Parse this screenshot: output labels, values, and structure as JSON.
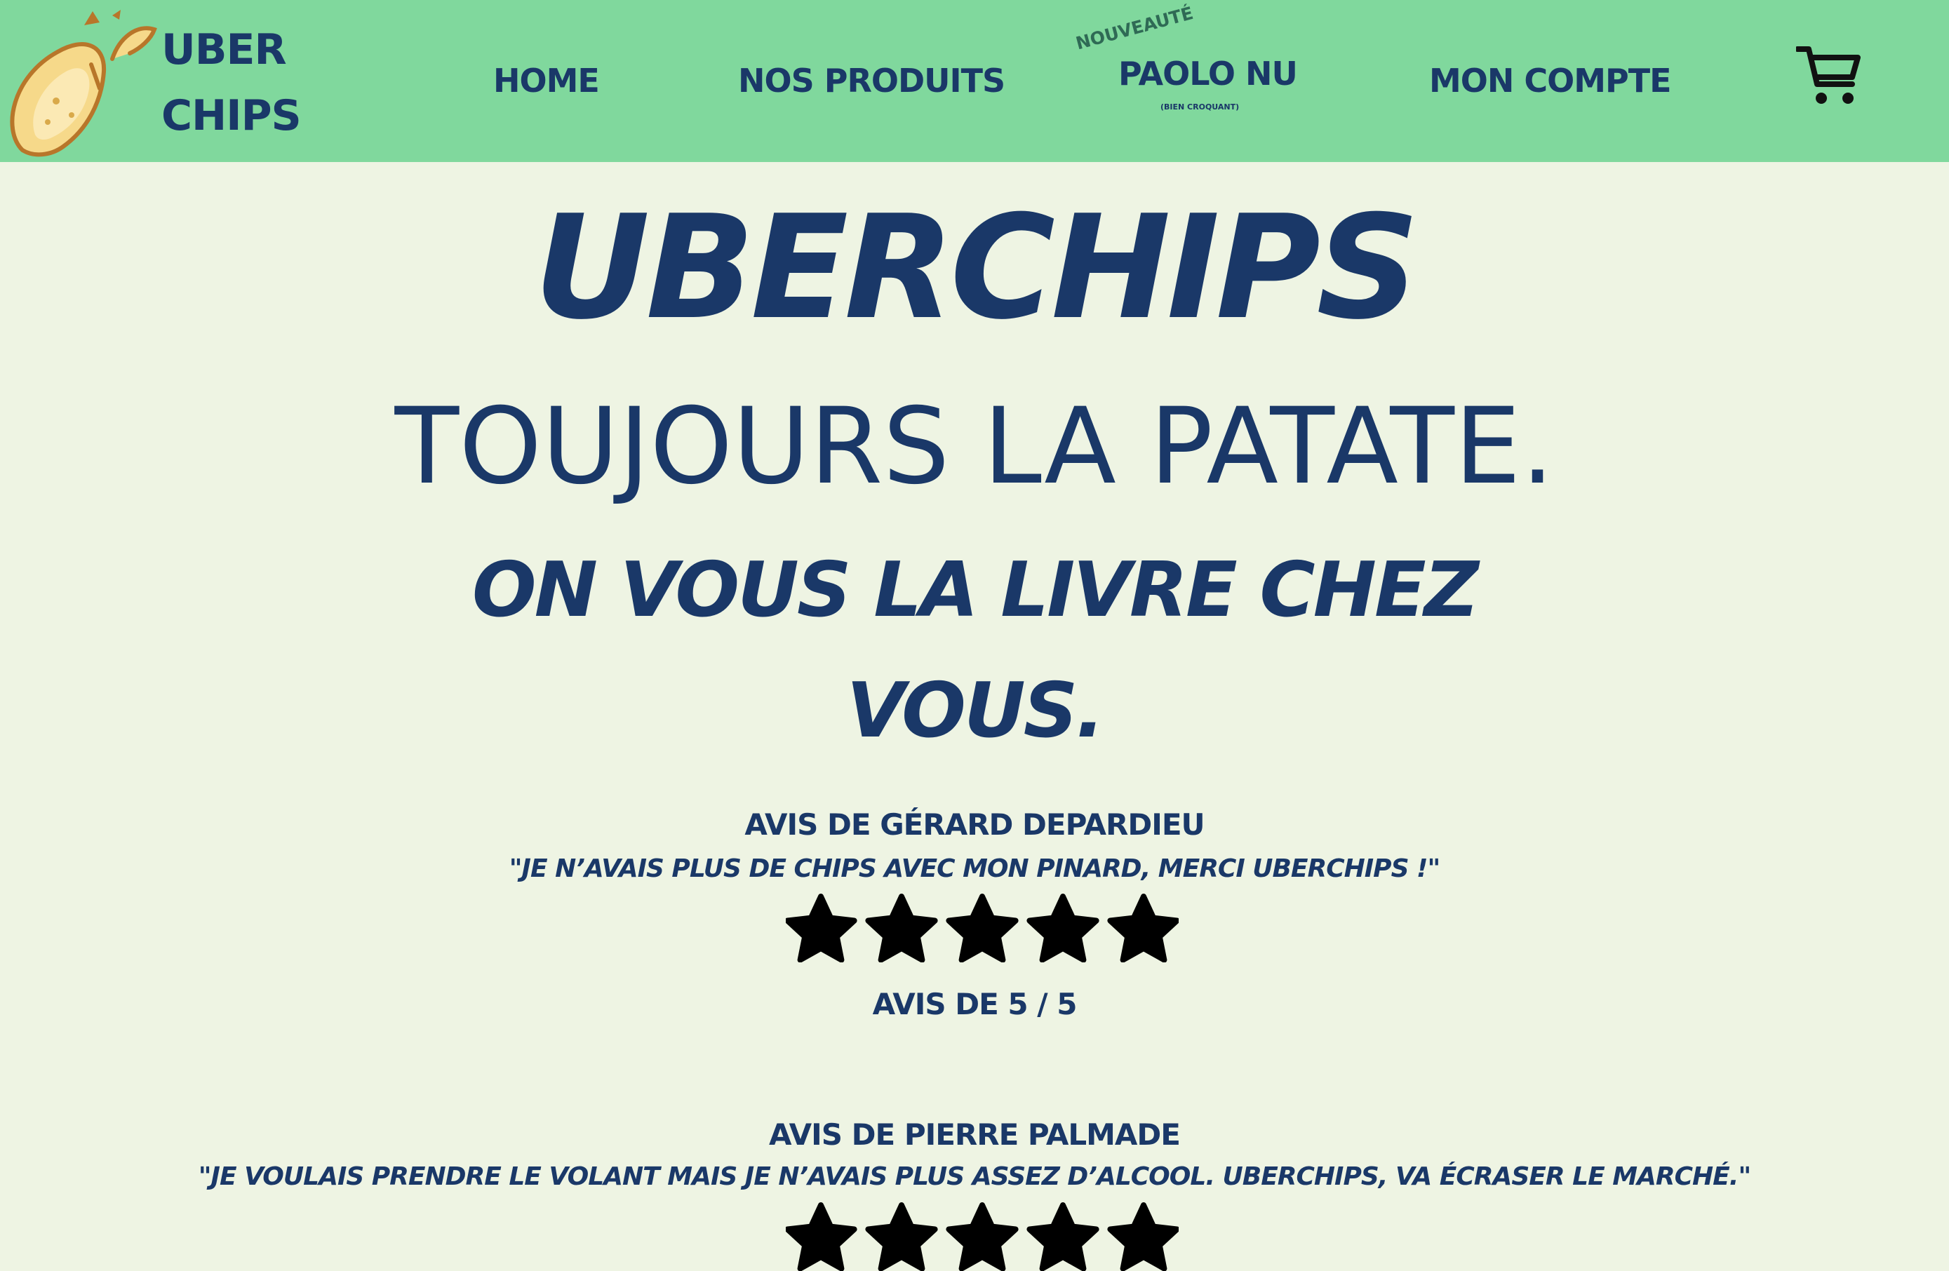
{
  "header": {
    "brand_line1": "UBER",
    "brand_line2": "CHIPS",
    "logo_icon": "chip-logo-icon",
    "nav": {
      "home": "HOME",
      "produits": "NOS PRODUITS",
      "paolo": "PAOLO NU",
      "paolo_badge": "NOUVEAUTÉ",
      "paolo_sub": "(BIEN CROQUANT)",
      "compte": "MON COMPTE"
    },
    "cart_icon": "cart-icon"
  },
  "hero": {
    "title": "UBERCHIPS",
    "tagline": "TOUJOURS LA PATATE.",
    "subtitle_line1": "ON VOUS LA LIVRE CHEZ",
    "subtitle_line2": "VOUS."
  },
  "reviews": [
    {
      "author": "AVIS DE GÉRARD DEPARDIEU",
      "quote": "\"JE N’AVAIS PLUS DE CHIPS AVEC MON PINARD, MERCI UBERCHIPS !\"",
      "stars": 5,
      "rating_text": "AVIS DE 5 / 5"
    },
    {
      "author": "AVIS DE PIERRE PALMADE",
      "quote": "\"JE VOULAIS PRENDRE LE VOLANT MAIS JE N’AVAIS PLUS ASSEZ D’ALCOOL. UBERCHIPS, VA ÉCRASER LE MARCHÉ.\"",
      "stars": 5
    }
  ],
  "colors": {
    "navbar_bg": "#80d89d",
    "page_bg": "#eef4e3",
    "text_navy": "#1a3868",
    "badge_green": "#2f6a55",
    "star": "#000000"
  }
}
